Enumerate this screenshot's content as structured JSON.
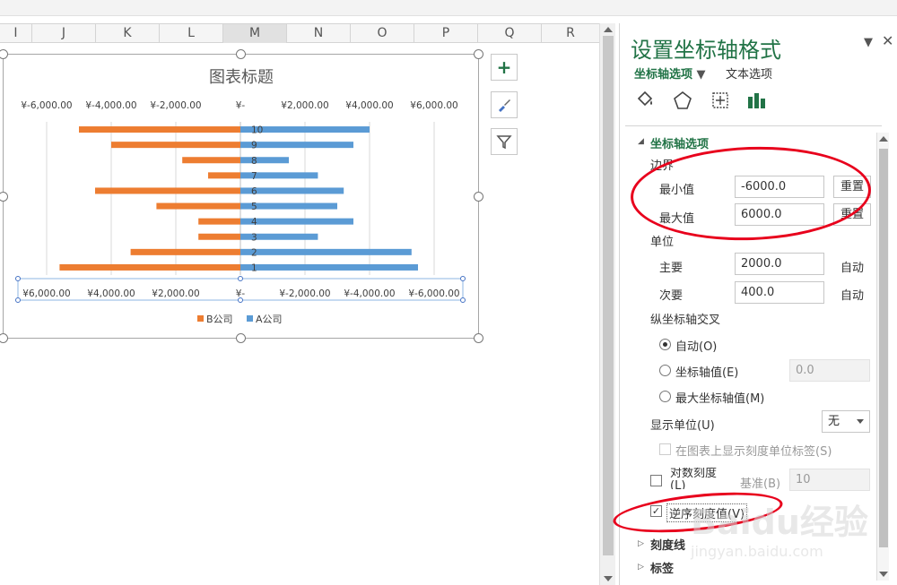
{
  "columns": [
    "I",
    "J",
    "K",
    "L",
    "M",
    "N",
    "O",
    "P",
    "Q",
    "R"
  ],
  "chart_data": {
    "type": "bar",
    "orientation": "horizontal-diverging",
    "title": "图表标题",
    "categories": [
      "1",
      "2",
      "3",
      "4",
      "5",
      "6",
      "7",
      "8",
      "9",
      "10"
    ],
    "series": [
      {
        "name": "A公司",
        "color": "#5b9bd5",
        "values": [
          5500,
          5300,
          2400,
          3500,
          3000,
          3200,
          2400,
          1500,
          3500,
          4000
        ]
      },
      {
        "name": "B公司",
        "color": "#ed7d31",
        "values": [
          -5600,
          -3400,
          -1300,
          -1300,
          -2600,
          -4500,
          -1000,
          -1800,
          -4000,
          -5000
        ]
      }
    ],
    "top_axis_ticks": [
      "¥-6,000.00",
      "¥-4,000.00",
      "¥-2,000.00",
      "¥-",
      "¥2,000.00",
      "¥4,000.00",
      "¥6,000.00"
    ],
    "bottom_axis_ticks": [
      "¥6,000.00",
      "¥4,000.00",
      "¥2,000.00",
      "¥-",
      "¥-2,000.00",
      "¥-4,000.00",
      "¥-6,000.00"
    ],
    "xlim": [
      -6000,
      6000
    ],
    "legend_position": "bottom",
    "grid": true
  },
  "chart_side_buttons": {
    "add": "+",
    "style": "brush-icon",
    "filter": "filter-icon"
  },
  "panel": {
    "title": "设置坐标轴格式",
    "tab_axis_options": "坐标轴选项",
    "tab_text_options": "文本选项",
    "section_axis_options": "坐标轴选项",
    "bounds_label": "边界",
    "min_label": "最小值",
    "min_value": "-6000.0",
    "max_label": "最大值",
    "max_value": "6000.0",
    "reset_label": "重置",
    "units_label": "单位",
    "major_label": "主要",
    "major_value": "2000.0",
    "minor_label": "次要",
    "minor_value": "400.0",
    "auto_label": "自动",
    "cross_label": "纵坐标轴交叉",
    "cross_auto": "自动(O)",
    "cross_value": "坐标轴值(E)",
    "cross_value_input": "0.0",
    "cross_max": "最大坐标轴值(M)",
    "display_units_label": "显示单位(U)",
    "display_units_value": "无",
    "show_units_label": "在图表上显示刻度单位标签(S)",
    "log_scale_label": "对数刻度(L)",
    "log_base_label": "基准(B)",
    "log_base_value": "10",
    "reverse_label": "逆序刻度值(V)",
    "tick_marks_label": "刻度线",
    "labels_label": "标签"
  },
  "watermark": {
    "brand": "Baidu经验",
    "url": "jingyan.baidu.com"
  }
}
